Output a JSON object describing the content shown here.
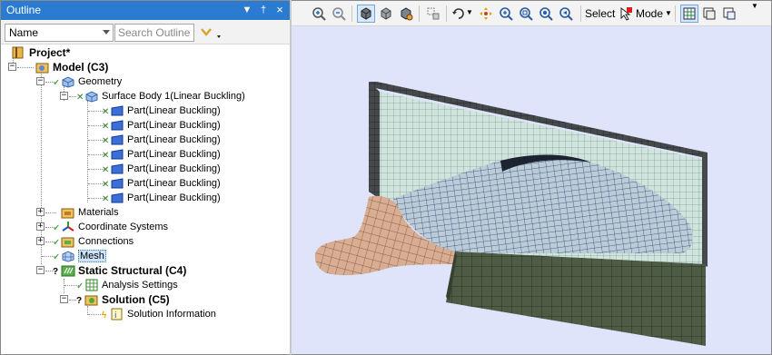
{
  "outline": {
    "title": "Outline",
    "controls": {
      "dropdown": "▼",
      "pin": "†",
      "close": "×"
    },
    "filter": {
      "selected": "Name",
      "search_placeholder": "Search Outline"
    },
    "tree": {
      "project": "Project*",
      "model": "Model (C3)",
      "geometry": "Geometry",
      "surface_body": "Surface Body 1(Linear Buckling)",
      "parts": [
        "Part(Linear Buckling)",
        "Part(Linear Buckling)",
        "Part(Linear Buckling)",
        "Part(Linear Buckling)",
        "Part(Linear Buckling)",
        "Part(Linear Buckling)",
        "Part(Linear Buckling)"
      ],
      "materials": "Materials",
      "coordinate_systems": "Coordinate Systems",
      "connections": "Connections",
      "mesh": "Mesh",
      "static_structural": "Static Structural (C4)",
      "analysis_settings": "Analysis Settings",
      "solution": "Solution (C5)",
      "solution_information": "Solution Information"
    }
  },
  "toolbar": {
    "select_label": "Select",
    "mode_label": "Mode"
  },
  "colors": {
    "title_bar": "#2b7bd1",
    "viewport_bg": "#dfe4fa",
    "wall_face": "#cfe4dc",
    "dark_face": "#45494b",
    "deformed_face": "#c7d6d8",
    "flange_face": "#d8ad92",
    "base_face": "#4e5b45"
  }
}
